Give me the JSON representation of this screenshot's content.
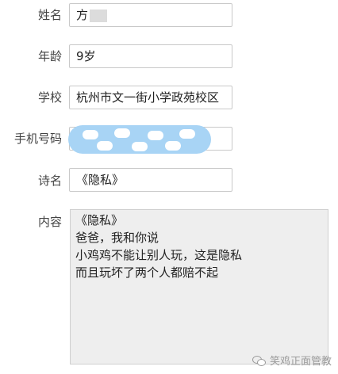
{
  "form": {
    "name": {
      "label": "姓名",
      "value": "方"
    },
    "age": {
      "label": "年龄",
      "value": "9岁"
    },
    "school": {
      "label": "学校",
      "value": "杭州市文一街小学政苑校区"
    },
    "phone": {
      "label": "手机号码",
      "value": ""
    },
    "poem_title": {
      "label": "诗名",
      "value": "《隐私》"
    },
    "content": {
      "label": "内容",
      "lines": [
        "《隐私》",
        "爸爸，我和你说",
        "小鸡鸡不能让别人玩，这是隐私",
        "而且玩坏了两个人都赔不起"
      ]
    }
  },
  "watermark": {
    "text": "笑鸡正面管教"
  }
}
